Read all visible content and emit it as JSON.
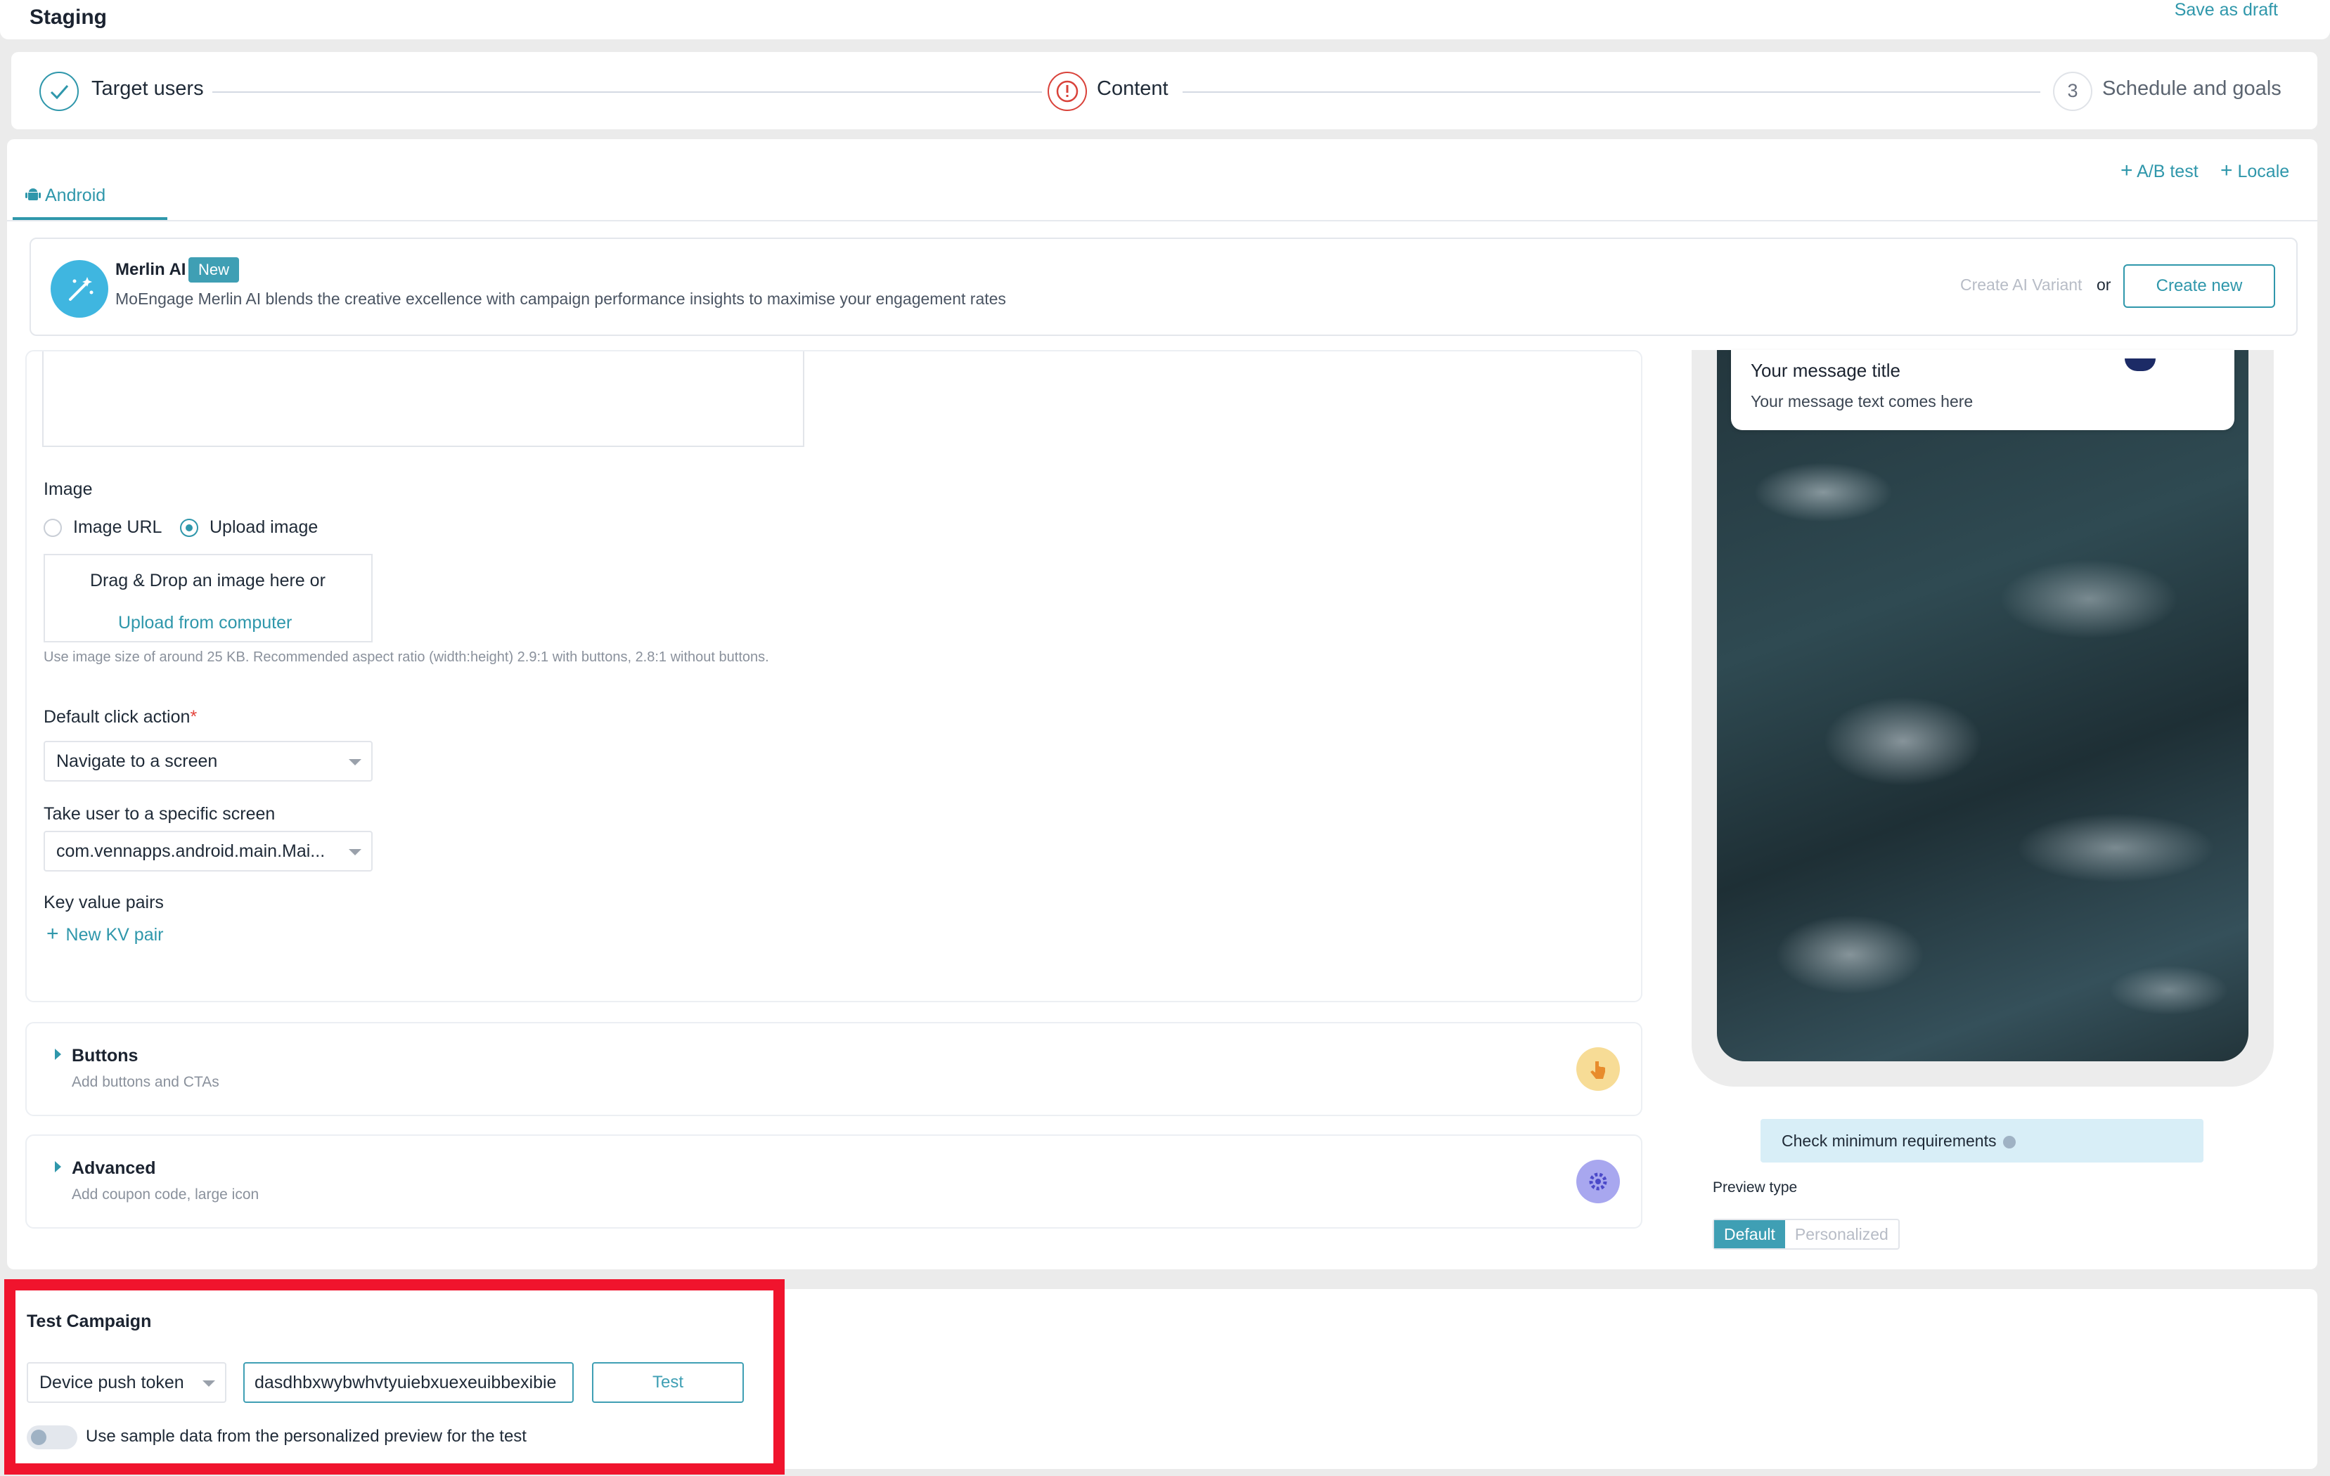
{
  "header": {
    "title": "Staging",
    "save_draft": "Save as draft"
  },
  "stepper": {
    "steps": [
      {
        "label": "Target users",
        "state": "done"
      },
      {
        "label": "Content",
        "state": "error"
      },
      {
        "number": "3",
        "label": "Schedule and goals",
        "state": "pending"
      }
    ]
  },
  "tabs": {
    "android": "Android",
    "ab_test": "A/B test",
    "locale": "Locale"
  },
  "merlin": {
    "title": "Merlin AI",
    "badge": "New",
    "description": "MoEngage Merlin AI blends the creative excellence with campaign performance insights to maximise your engagement rates",
    "create_ai_variant": "Create AI Variant",
    "or": "or",
    "create_new": "Create new"
  },
  "form": {
    "image_label": "Image",
    "image_options": [
      "Image URL",
      "Upload image"
    ],
    "image_selected": "Upload image",
    "dropzone_text": "Drag & Drop an image here or",
    "dropzone_link": "Upload from computer",
    "image_hint": "Use image size of around 25 KB. Recommended aspect ratio (width:height) 2.9:1 with buttons, 2.8:1 without buttons.",
    "click_action_label": "Default click action",
    "click_action_required": "*",
    "click_action_value": "Navigate to a screen",
    "screen_label": "Take user to a specific screen",
    "screen_value": "com.vennapps.android.main.Mai...",
    "kv_label": "Key value pairs",
    "kv_add": "New KV pair"
  },
  "accordions": {
    "buttons": {
      "title": "Buttons",
      "subtitle": "Add buttons and CTAs"
    },
    "advanced": {
      "title": "Advanced",
      "subtitle": "Add coupon code, large icon"
    }
  },
  "preview": {
    "message_title": "Your message title",
    "message_text": "Your message text comes here",
    "check_requirements": "Check minimum requirements",
    "preview_type_label": "Preview type",
    "preview_types": [
      "Default",
      "Personalized"
    ],
    "preview_selected": "Default"
  },
  "test_campaign": {
    "title": "Test Campaign",
    "token_type": "Device push token",
    "token_value": "dasdhbxwybwhvtyuiebxuexeuibbexibie",
    "test_button": "Test",
    "sample_data_label": "Use sample data from the personalized preview for the test",
    "sample_data_enabled": false
  },
  "colors": {
    "accent": "#2f97ab",
    "error": "#d9423a",
    "highlight_box": "#f0142d"
  }
}
